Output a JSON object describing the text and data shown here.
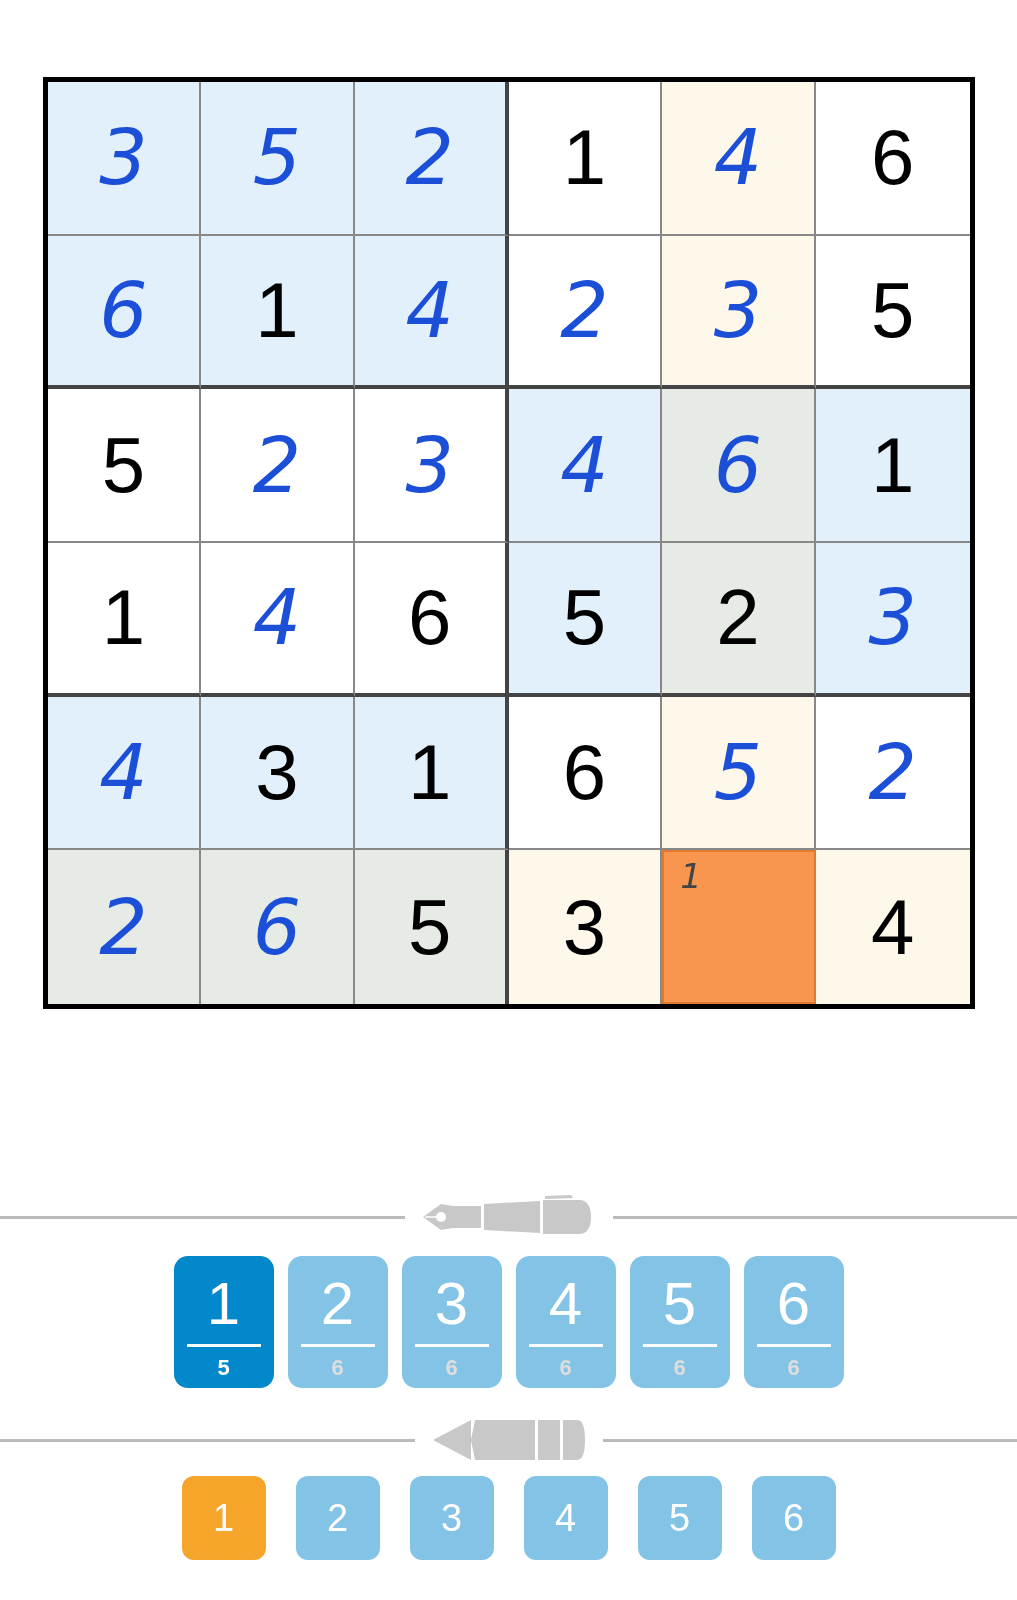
{
  "grid": {
    "rows": [
      [
        {
          "value": "3",
          "kind": "entered",
          "color": "#e2f0fb",
          "selected": false
        },
        {
          "value": "5",
          "kind": "entered",
          "color": "#e2f0fb",
          "selected": false
        },
        {
          "value": "2",
          "kind": "entered",
          "color": "#e2f0fb",
          "selected": false
        },
        {
          "value": "1",
          "kind": "given",
          "color": "#ffffff",
          "selected": false
        },
        {
          "value": "4",
          "kind": "entered",
          "color": "#fdf8e9",
          "selected": false
        },
        {
          "value": "6",
          "kind": "given",
          "color": "#ffffff",
          "selected": false
        }
      ],
      [
        {
          "value": "6",
          "kind": "entered",
          "color": "#e2f0fb",
          "selected": false
        },
        {
          "value": "1",
          "kind": "given",
          "color": "#e2f0fb",
          "selected": false
        },
        {
          "value": "4",
          "kind": "entered",
          "color": "#e2f0fb",
          "selected": false
        },
        {
          "value": "2",
          "kind": "entered",
          "color": "#ffffff",
          "selected": false
        },
        {
          "value": "3",
          "kind": "entered",
          "color": "#fdf8e9",
          "selected": false
        },
        {
          "value": "5",
          "kind": "given",
          "color": "#ffffff",
          "selected": false
        }
      ],
      [
        {
          "value": "5",
          "kind": "given",
          "color": "#ffffff",
          "selected": false
        },
        {
          "value": "2",
          "kind": "entered",
          "color": "#ffffff",
          "selected": false
        },
        {
          "value": "3",
          "kind": "entered",
          "color": "#ffffff",
          "selected": false
        },
        {
          "value": "4",
          "kind": "entered",
          "color": "#e2f0fb",
          "selected": false
        },
        {
          "value": "6",
          "kind": "entered",
          "color": "#e6ebe5",
          "selected": false
        },
        {
          "value": "1",
          "kind": "given",
          "color": "#e2f0fb",
          "selected": false
        }
      ],
      [
        {
          "value": "1",
          "kind": "given",
          "color": "#ffffff",
          "selected": false
        },
        {
          "value": "4",
          "kind": "entered",
          "color": "#ffffff",
          "selected": false
        },
        {
          "value": "6",
          "kind": "given",
          "color": "#ffffff",
          "selected": false
        },
        {
          "value": "5",
          "kind": "given",
          "color": "#e2f0fb",
          "selected": false
        },
        {
          "value": "2",
          "kind": "given",
          "color": "#e6ebe5",
          "selected": false
        },
        {
          "value": "3",
          "kind": "entered",
          "color": "#e2f0fb",
          "selected": false
        }
      ],
      [
        {
          "value": "4",
          "kind": "entered",
          "color": "#e2f0fb",
          "selected": false
        },
        {
          "value": "3",
          "kind": "given",
          "color": "#e2f0fb",
          "selected": false
        },
        {
          "value": "1",
          "kind": "given",
          "color": "#e2f0fb",
          "selected": false
        },
        {
          "value": "6",
          "kind": "given",
          "color": "#ffffff",
          "selected": false
        },
        {
          "value": "5",
          "kind": "entered",
          "color": "#fdf8e9",
          "selected": false
        },
        {
          "value": "2",
          "kind": "entered",
          "color": "#ffffff",
          "selected": false
        }
      ],
      [
        {
          "value": "2",
          "kind": "entered",
          "color": "#e6ebe5",
          "selected": false
        },
        {
          "value": "6",
          "kind": "entered",
          "color": "#e6ebe5",
          "selected": false
        },
        {
          "value": "5",
          "kind": "given",
          "color": "#e6ebe5",
          "selected": false
        },
        {
          "value": "3",
          "kind": "given",
          "color": "#fdf8e9",
          "selected": false
        },
        {
          "value": "1",
          "kind": "note",
          "color": "#f8964f",
          "selected": true
        },
        {
          "value": "4",
          "kind": "given",
          "color": "#fdf8e9",
          "selected": false
        }
      ]
    ]
  },
  "pen_digits": [
    {
      "digit": "1",
      "count": "5",
      "selected": true
    },
    {
      "digit": "2",
      "count": "6",
      "selected": false
    },
    {
      "digit": "3",
      "count": "6",
      "selected": false
    },
    {
      "digit": "4",
      "count": "6",
      "selected": false
    },
    {
      "digit": "5",
      "count": "6",
      "selected": false
    },
    {
      "digit": "6",
      "count": "6",
      "selected": false
    }
  ],
  "pencil_digits": [
    {
      "digit": "1",
      "selected": true
    },
    {
      "digit": "2",
      "selected": false
    },
    {
      "digit": "3",
      "selected": false
    },
    {
      "digit": "4",
      "selected": false
    },
    {
      "digit": "5",
      "selected": false
    },
    {
      "digit": "6",
      "selected": false
    }
  ]
}
